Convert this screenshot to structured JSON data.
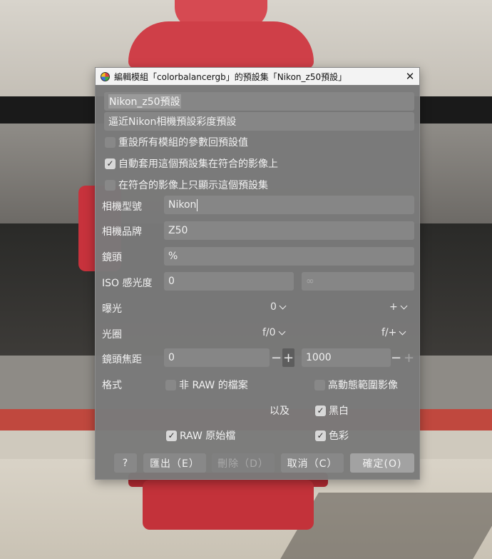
{
  "window": {
    "title": "編輯模組「colorbalancergb」的預設集「Nikon_z50預設」",
    "close_glyph": "✕"
  },
  "preset": {
    "name": "Nikon_z50預設",
    "description": "逼近Nikon相機預設彩度預設"
  },
  "options": [
    {
      "label": "重設所有模組的參數回預設值",
      "checked": false
    },
    {
      "label": "自動套用這個預設集在符合的影像上",
      "checked": true
    },
    {
      "label": "在符合的影像上只顯示這個預設集",
      "checked": false
    }
  ],
  "filters": {
    "maker_label": "相機型號",
    "maker_value": "Nikon",
    "model_label": "相機品牌",
    "model_value": "Z50",
    "lens_label": "鏡頭",
    "lens_value": "%",
    "iso_label": "ISO 感光度",
    "iso_min": "0",
    "iso_max": "∞",
    "exposure_label": "曝光",
    "exposure_min": "0",
    "exposure_max": "+",
    "aperture_label": "光圈",
    "aperture_min": "f/0",
    "aperture_max": "f/+",
    "focal_label": "鏡頭焦距",
    "focal_min": "0",
    "focal_max": "1000",
    "minus_glyph": "−",
    "plus_glyph": "+",
    "format_label": "格式",
    "and_label": "以及"
  },
  "formats": {
    "non_raw": {
      "label": "非 RAW 的檔案",
      "checked": false
    },
    "hdr": {
      "label": "高動態範圍影像",
      "checked": false
    },
    "monochrome": {
      "label": "黑白",
      "checked": true
    },
    "raw": {
      "label": "RAW 原始檔",
      "checked": true
    },
    "color": {
      "label": "色彩",
      "checked": true
    }
  },
  "buttons": {
    "help": "?",
    "export": "匯出（E）",
    "delete": "刪除（D）",
    "cancel": "取消（C）",
    "ok": "確定(O)"
  },
  "check_glyph": "✓"
}
